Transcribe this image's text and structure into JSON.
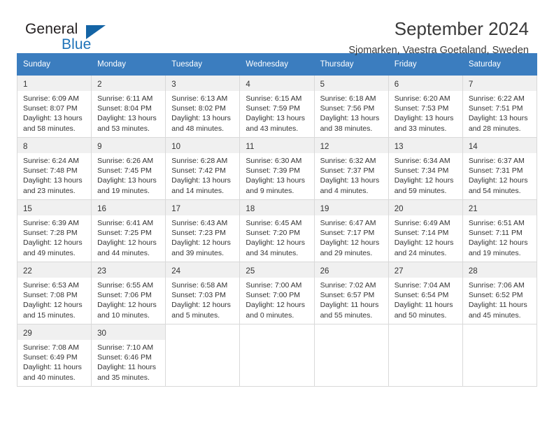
{
  "brand": {
    "name_top": "General",
    "name_bottom": "Blue",
    "accent_color": "#1464a5",
    "text_color": "#231f20"
  },
  "header": {
    "title": "September 2024",
    "subtitle": "Sjomarken, Vaestra Goetaland, Sweden"
  },
  "calendar": {
    "header_bg": "#3b7dbf",
    "header_text_color": "#ffffff",
    "daynum_bg": "#f0f0f0",
    "weekdays": [
      "Sunday",
      "Monday",
      "Tuesday",
      "Wednesday",
      "Thursday",
      "Friday",
      "Saturday"
    ],
    "weeks": [
      [
        {
          "day": "1",
          "sunrise": "Sunrise: 6:09 AM",
          "sunset": "Sunset: 8:07 PM",
          "daylight1": "Daylight: 13 hours",
          "daylight2": "and 58 minutes."
        },
        {
          "day": "2",
          "sunrise": "Sunrise: 6:11 AM",
          "sunset": "Sunset: 8:04 PM",
          "daylight1": "Daylight: 13 hours",
          "daylight2": "and 53 minutes."
        },
        {
          "day": "3",
          "sunrise": "Sunrise: 6:13 AM",
          "sunset": "Sunset: 8:02 PM",
          "daylight1": "Daylight: 13 hours",
          "daylight2": "and 48 minutes."
        },
        {
          "day": "4",
          "sunrise": "Sunrise: 6:15 AM",
          "sunset": "Sunset: 7:59 PM",
          "daylight1": "Daylight: 13 hours",
          "daylight2": "and 43 minutes."
        },
        {
          "day": "5",
          "sunrise": "Sunrise: 6:18 AM",
          "sunset": "Sunset: 7:56 PM",
          "daylight1": "Daylight: 13 hours",
          "daylight2": "and 38 minutes."
        },
        {
          "day": "6",
          "sunrise": "Sunrise: 6:20 AM",
          "sunset": "Sunset: 7:53 PM",
          "daylight1": "Daylight: 13 hours",
          "daylight2": "and 33 minutes."
        },
        {
          "day": "7",
          "sunrise": "Sunrise: 6:22 AM",
          "sunset": "Sunset: 7:51 PM",
          "daylight1": "Daylight: 13 hours",
          "daylight2": "and 28 minutes."
        }
      ],
      [
        {
          "day": "8",
          "sunrise": "Sunrise: 6:24 AM",
          "sunset": "Sunset: 7:48 PM",
          "daylight1": "Daylight: 13 hours",
          "daylight2": "and 23 minutes."
        },
        {
          "day": "9",
          "sunrise": "Sunrise: 6:26 AM",
          "sunset": "Sunset: 7:45 PM",
          "daylight1": "Daylight: 13 hours",
          "daylight2": "and 19 minutes."
        },
        {
          "day": "10",
          "sunrise": "Sunrise: 6:28 AM",
          "sunset": "Sunset: 7:42 PM",
          "daylight1": "Daylight: 13 hours",
          "daylight2": "and 14 minutes."
        },
        {
          "day": "11",
          "sunrise": "Sunrise: 6:30 AM",
          "sunset": "Sunset: 7:39 PM",
          "daylight1": "Daylight: 13 hours",
          "daylight2": "and 9 minutes."
        },
        {
          "day": "12",
          "sunrise": "Sunrise: 6:32 AM",
          "sunset": "Sunset: 7:37 PM",
          "daylight1": "Daylight: 13 hours",
          "daylight2": "and 4 minutes."
        },
        {
          "day": "13",
          "sunrise": "Sunrise: 6:34 AM",
          "sunset": "Sunset: 7:34 PM",
          "daylight1": "Daylight: 12 hours",
          "daylight2": "and 59 minutes."
        },
        {
          "day": "14",
          "sunrise": "Sunrise: 6:37 AM",
          "sunset": "Sunset: 7:31 PM",
          "daylight1": "Daylight: 12 hours",
          "daylight2": "and 54 minutes."
        }
      ],
      [
        {
          "day": "15",
          "sunrise": "Sunrise: 6:39 AM",
          "sunset": "Sunset: 7:28 PM",
          "daylight1": "Daylight: 12 hours",
          "daylight2": "and 49 minutes."
        },
        {
          "day": "16",
          "sunrise": "Sunrise: 6:41 AM",
          "sunset": "Sunset: 7:25 PM",
          "daylight1": "Daylight: 12 hours",
          "daylight2": "and 44 minutes."
        },
        {
          "day": "17",
          "sunrise": "Sunrise: 6:43 AM",
          "sunset": "Sunset: 7:23 PM",
          "daylight1": "Daylight: 12 hours",
          "daylight2": "and 39 minutes."
        },
        {
          "day": "18",
          "sunrise": "Sunrise: 6:45 AM",
          "sunset": "Sunset: 7:20 PM",
          "daylight1": "Daylight: 12 hours",
          "daylight2": "and 34 minutes."
        },
        {
          "day": "19",
          "sunrise": "Sunrise: 6:47 AM",
          "sunset": "Sunset: 7:17 PM",
          "daylight1": "Daylight: 12 hours",
          "daylight2": "and 29 minutes."
        },
        {
          "day": "20",
          "sunrise": "Sunrise: 6:49 AM",
          "sunset": "Sunset: 7:14 PM",
          "daylight1": "Daylight: 12 hours",
          "daylight2": "and 24 minutes."
        },
        {
          "day": "21",
          "sunrise": "Sunrise: 6:51 AM",
          "sunset": "Sunset: 7:11 PM",
          "daylight1": "Daylight: 12 hours",
          "daylight2": "and 19 minutes."
        }
      ],
      [
        {
          "day": "22",
          "sunrise": "Sunrise: 6:53 AM",
          "sunset": "Sunset: 7:08 PM",
          "daylight1": "Daylight: 12 hours",
          "daylight2": "and 15 minutes."
        },
        {
          "day": "23",
          "sunrise": "Sunrise: 6:55 AM",
          "sunset": "Sunset: 7:06 PM",
          "daylight1": "Daylight: 12 hours",
          "daylight2": "and 10 minutes."
        },
        {
          "day": "24",
          "sunrise": "Sunrise: 6:58 AM",
          "sunset": "Sunset: 7:03 PM",
          "daylight1": "Daylight: 12 hours",
          "daylight2": "and 5 minutes."
        },
        {
          "day": "25",
          "sunrise": "Sunrise: 7:00 AM",
          "sunset": "Sunset: 7:00 PM",
          "daylight1": "Daylight: 12 hours",
          "daylight2": "and 0 minutes."
        },
        {
          "day": "26",
          "sunrise": "Sunrise: 7:02 AM",
          "sunset": "Sunset: 6:57 PM",
          "daylight1": "Daylight: 11 hours",
          "daylight2": "and 55 minutes."
        },
        {
          "day": "27",
          "sunrise": "Sunrise: 7:04 AM",
          "sunset": "Sunset: 6:54 PM",
          "daylight1": "Daylight: 11 hours",
          "daylight2": "and 50 minutes."
        },
        {
          "day": "28",
          "sunrise": "Sunrise: 7:06 AM",
          "sunset": "Sunset: 6:52 PM",
          "daylight1": "Daylight: 11 hours",
          "daylight2": "and 45 minutes."
        }
      ],
      [
        {
          "day": "29",
          "sunrise": "Sunrise: 7:08 AM",
          "sunset": "Sunset: 6:49 PM",
          "daylight1": "Daylight: 11 hours",
          "daylight2": "and 40 minutes."
        },
        {
          "day": "30",
          "sunrise": "Sunrise: 7:10 AM",
          "sunset": "Sunset: 6:46 PM",
          "daylight1": "Daylight: 11 hours",
          "daylight2": "and 35 minutes."
        },
        {
          "day": "",
          "sunrise": "",
          "sunset": "",
          "daylight1": "",
          "daylight2": ""
        },
        {
          "day": "",
          "sunrise": "",
          "sunset": "",
          "daylight1": "",
          "daylight2": ""
        },
        {
          "day": "",
          "sunrise": "",
          "sunset": "",
          "daylight1": "",
          "daylight2": ""
        },
        {
          "day": "",
          "sunrise": "",
          "sunset": "",
          "daylight1": "",
          "daylight2": ""
        },
        {
          "day": "",
          "sunrise": "",
          "sunset": "",
          "daylight1": "",
          "daylight2": ""
        }
      ]
    ]
  }
}
